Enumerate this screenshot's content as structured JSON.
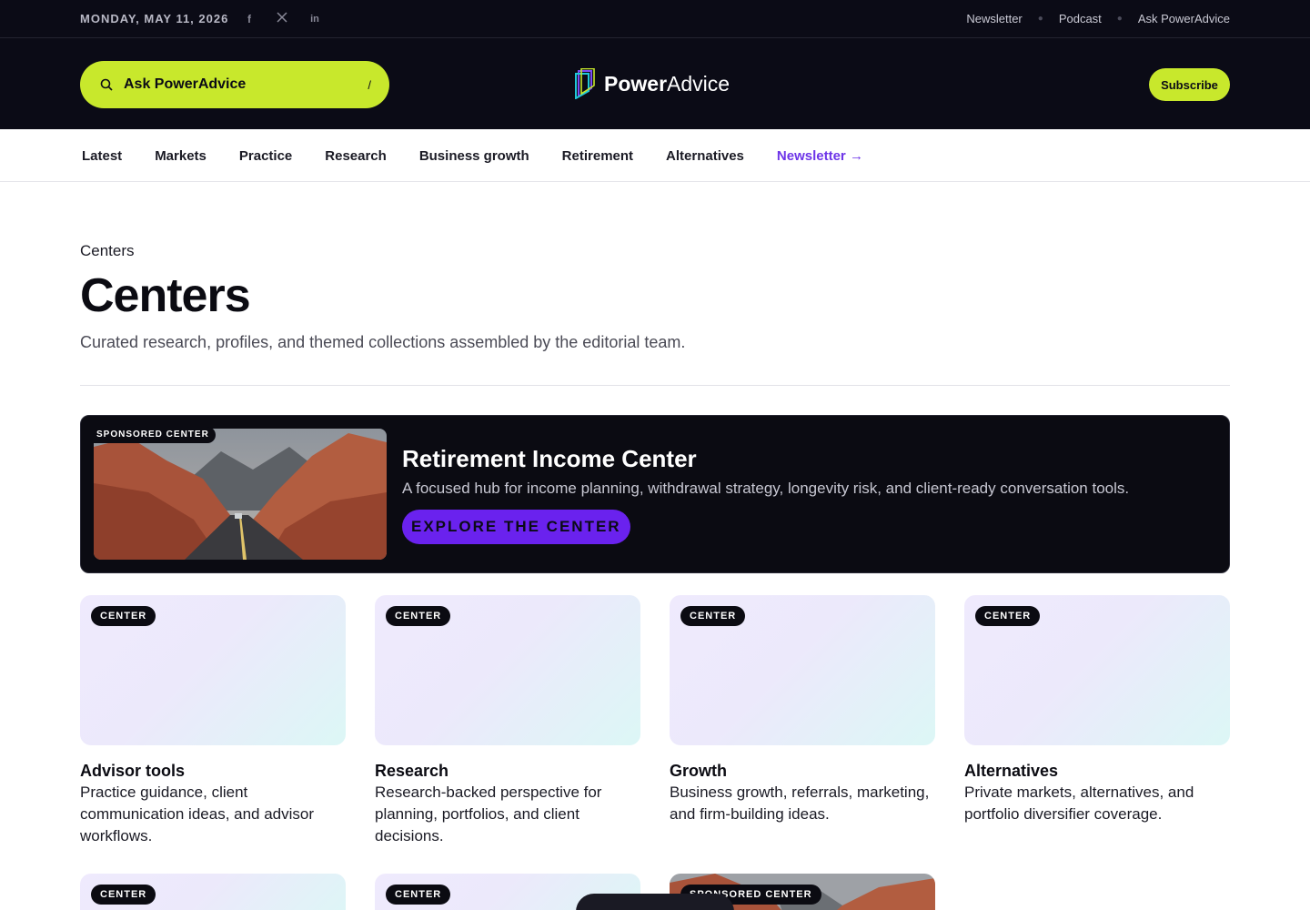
{
  "topbar": {
    "date": "MONDAY, MAY 11, 2026",
    "social": [
      "facebook-icon",
      "x-icon",
      "linkedin-icon"
    ],
    "links": [
      "Newsletter",
      "Podcast",
      "Ask PowerAdvice"
    ]
  },
  "header": {
    "search_label": "Ask PowerAdvice",
    "search_shortcut": "/",
    "logo_power": "Power",
    "logo_advice": "Advice",
    "subscribe": "Subscribe"
  },
  "nav": {
    "items": [
      "Latest",
      "Markets",
      "Practice",
      "Research",
      "Business growth",
      "Retirement",
      "Alternatives"
    ],
    "newsletter": "Newsletter →"
  },
  "page": {
    "breadcrumb": "Centers",
    "title": "Centers",
    "subtitle": "Curated research, profiles, and themed collections assembled by the editorial team."
  },
  "featured": {
    "badge": "SPONSORED CENTER",
    "title": "Retirement Income Center",
    "description": "A focused hub for income planning, withdrawal strategy, longevity risk, and client-ready conversation tools.",
    "cta": "EXPLORE THE CENTER"
  },
  "cards": [
    {
      "badge": "CENTER",
      "title": "Advisor tools",
      "description": "Practice guidance, client communication ideas, and advisor workflows."
    },
    {
      "badge": "CENTER",
      "title": "Research",
      "description": "Research-backed perspective for planning, portfolios, and client decisions."
    },
    {
      "badge": "CENTER",
      "title": "Growth",
      "description": "Business growth, referrals, marketing, and firm-building ideas."
    },
    {
      "badge": "CENTER",
      "title": "Alternatives",
      "description": "Private markets, alternatives, and portfolio diversifier coverage."
    }
  ],
  "next_row": {
    "badges": [
      "CENTER",
      "CENTER",
      "SPONSORED CENTER"
    ]
  },
  "colors": {
    "dark": "#0b0b16",
    "lime": "#c8e82c",
    "purple": "#6d34e8",
    "cta_purple": "#6a22ee"
  }
}
